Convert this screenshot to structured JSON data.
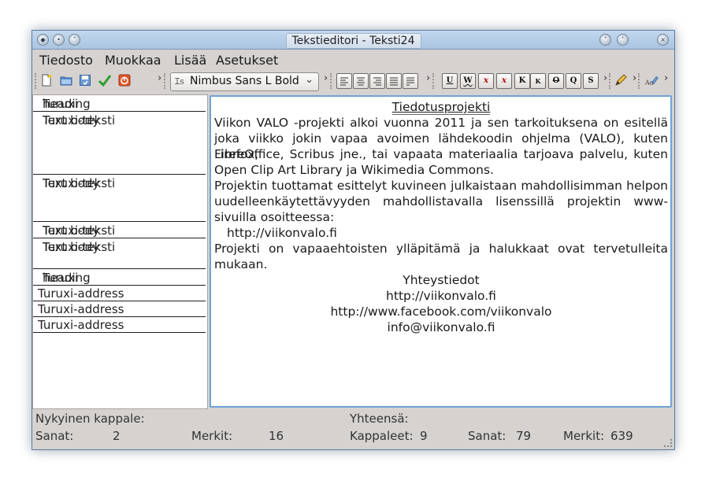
{
  "window": {
    "title": "Tekstieditori - Teksti24"
  },
  "menu": [
    "Tiedosto",
    "Muokkaa",
    "Lisää",
    "Asetukset"
  ],
  "toolbar": {
    "font": "Nimbus Sans L Bold",
    "file_icons": [
      "new-document-icon",
      "open-folder-icon",
      "save-icon",
      "check-icon",
      "quit-icon"
    ],
    "align_icons": [
      "align-left-icon",
      "align-center-icon",
      "align-right-icon",
      "align-justify-icon",
      "align-full-icon"
    ],
    "format": [
      "U",
      "W",
      "x",
      "x",
      "K",
      "K",
      "O",
      "Q",
      "S"
    ]
  },
  "paragraphs": [
    {
      "style": "Turuxi",
      "type": "heading"
    },
    {
      "style": "Turuxi-teksti",
      "type": "Text body"
    },
    {
      "style": "Turuxi-teksti",
      "type": "Text body"
    },
    {
      "style": "Turuxi-teksti",
      "type": "Text body"
    },
    {
      "style": "Turuxi-teksti",
      "type": "Text body"
    },
    {
      "style": "Turuxi",
      "type": "heading"
    },
    {
      "style": "Turuxi-address",
      "type": ""
    },
    {
      "style": "Turuxi-address",
      "type": ""
    },
    {
      "style": "Turuxi-address",
      "type": ""
    }
  ],
  "document": {
    "heading": "Tiedotusprojekti",
    "para1_lines": [
      "Viikon VALO -projekti alkoi vuonna 2011 ja sen tarkoituksena on esitellä",
      "joka viikko jokin vapaa avoimen lähdekoodin ohjelma (VALO), kuten Firefox,",
      "LibreOffice, Scribus jne., tai vapaata materiaalia tarjoava palvelu, kuten"
    ],
    "para1_last": "Open Clip Art Library ja Wikimedia Commons.",
    "para2_lines": [
      "Projektin tuottamat esittelyt kuvineen julkaistaan mahdollisimman helpon",
      "uudelleenkäytettävyyden mahdollistavalla lisenssillä projektin www-"
    ],
    "para2_last": "sivuilla osoitteessa:",
    "link": "http://viikonvalo.fi",
    "para4_line": "Projekti on vapaaehtoisten ylläpitämä ja halukkaat ovat tervetulleita",
    "para4_last": "mukaan.",
    "contact_heading": "Yhteystiedot",
    "contacts": [
      "http://viikonvalo.fi",
      "http://www.facebook.com/viikonvalo",
      "info@viikonvalo.fi"
    ]
  },
  "status": {
    "current_label": "Nykyinen kappale:",
    "total_label": "Yhteensä:",
    "words_label": "Sanat:",
    "words": "2",
    "chars_label": "Merkit:",
    "chars": "16",
    "paragraphs_label": "Kappaleet:",
    "total_paragraphs": "9",
    "total_words_label": "Sanat:",
    "total_words": "79",
    "total_chars_label": "Merkit:",
    "total_chars": "639"
  }
}
